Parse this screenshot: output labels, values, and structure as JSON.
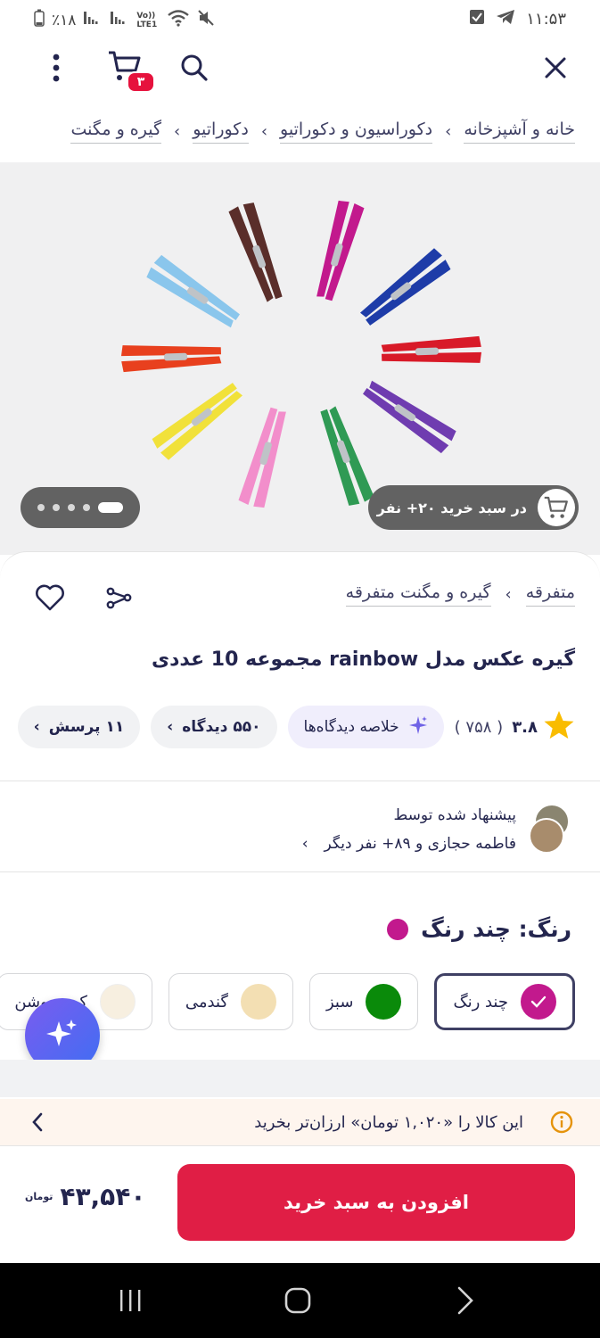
{
  "status_bar": {
    "battery": "٪۱۸",
    "net": "Vo)) LTE1",
    "time": "۱۱:۵۳"
  },
  "top_bar": {
    "cart_count": "۳",
    "icons": [
      "close-icon",
      "search-icon",
      "cart-icon",
      "more-icon"
    ]
  },
  "breadcrumb": {
    "items": [
      "خانه و آشپزخانه",
      "دکوراسیون و دکوراتیو",
      "دکوراتیو",
      "گیره و مگنت"
    ]
  },
  "gallery": {
    "social_text": "در سبد خرید ۲۰+ نفر",
    "pager_total": 5,
    "pager_active": 5,
    "clothespin_colors": [
      "#5a2e2a",
      "#c2198d",
      "#1e3ca8",
      "#d81a28",
      "#6f3cb0",
      "#2f9a54",
      "#f28ecb",
      "#f1e13a",
      "#e8401e",
      "#8ac6ec"
    ]
  },
  "product": {
    "category_links": [
      "متفرقه",
      "گیره و مگنت متفرقه"
    ],
    "title": "گیره عکس مدل rainbow مجموعه 10 عددی",
    "rating": "۳.۸",
    "rating_count": "( ۷۵۸ )",
    "ai_summary": "خلاصه دیدگاه‌ها",
    "comments": "۵۵۰ دیدگاه",
    "questions": "۱۱ پرسش",
    "suggest_title": "پیشنهاد شده توسط",
    "suggest_people": "فاطمه حجازی و ۸۹+ نفر دیگر",
    "color_label": "رنگ: چند رنگ",
    "selected_color_hex": "#c2198d",
    "color_options": [
      {
        "name": "چند رنگ",
        "hex": "#c2198d",
        "selected": true
      },
      {
        "name": "سبز",
        "hex": "#0a8a0a",
        "selected": false
      },
      {
        "name": "گندمی",
        "hex": "#f3dfb3",
        "selected": false
      },
      {
        "name": "کرم روشن",
        "hex": "#f7efe0",
        "selected": false
      }
    ]
  },
  "notice": {
    "text": "این کالا را «۱,۰۲۰ تومان» ارزان‌تر بخرید"
  },
  "buy_bar": {
    "add_to_cart": "افزودن به سبد خرید",
    "price": "۴۳,۵۴۰",
    "currency": "تومان"
  }
}
